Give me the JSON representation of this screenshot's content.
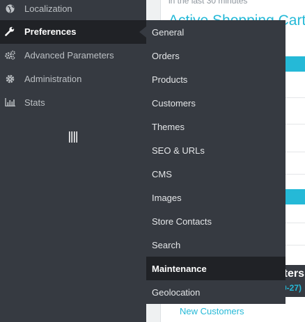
{
  "background_page": {
    "subtitle": "in the last 30 minutes",
    "title": "Active Shopping Cart",
    "dark_block": {
      "title": "ters",
      "subtitle": "9-27)"
    },
    "new_customers_link": "New Customers"
  },
  "sidebar": {
    "items": [
      {
        "label": "Localization",
        "icon": "globe-icon",
        "active": false
      },
      {
        "label": "Preferences",
        "icon": "wrench-icon",
        "active": true
      },
      {
        "label": "Advanced Parameters",
        "icon": "cogs-icon",
        "active": false
      },
      {
        "label": "Administration",
        "icon": "gear-icon",
        "active": false
      },
      {
        "label": "Stats",
        "icon": "bar-chart-icon",
        "active": false
      }
    ],
    "collapse_icon": "collapse-handle-icon"
  },
  "submenu": {
    "parent": "Preferences",
    "items": [
      {
        "label": "General",
        "active": false
      },
      {
        "label": "Orders",
        "active": false
      },
      {
        "label": "Products",
        "active": false
      },
      {
        "label": "Customers",
        "active": false
      },
      {
        "label": "Themes",
        "active": false
      },
      {
        "label": "SEO & URLs",
        "active": false
      },
      {
        "label": "CMS",
        "active": false
      },
      {
        "label": "Images",
        "active": false
      },
      {
        "label": "Store Contacts",
        "active": false
      },
      {
        "label": "Search",
        "active": false
      },
      {
        "label": "Maintenance",
        "active": true
      },
      {
        "label": "Geolocation",
        "active": false
      }
    ]
  },
  "colors": {
    "sidebar_bg": "#363a41",
    "active_bg": "#202226",
    "accent": "#25b9d7"
  }
}
